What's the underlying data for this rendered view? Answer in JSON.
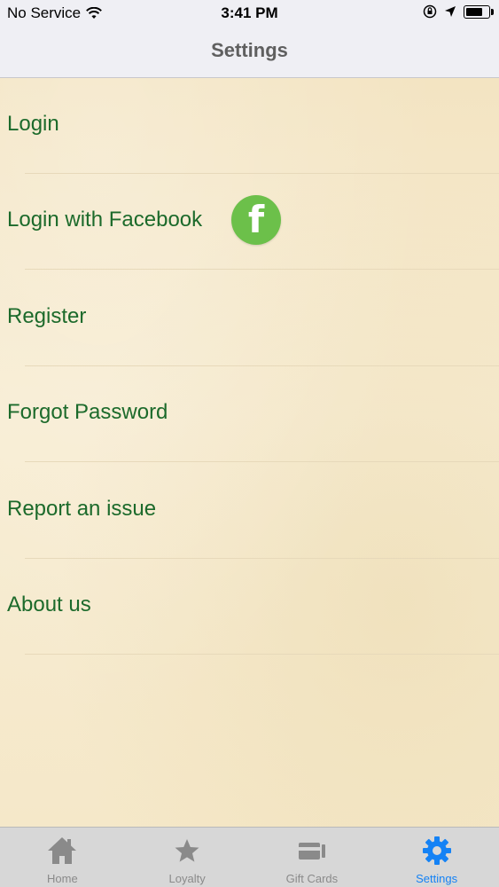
{
  "status_bar": {
    "carrier": "No Service",
    "time": "3:41 PM"
  },
  "nav": {
    "title": "Settings"
  },
  "menu": [
    {
      "label": "Login"
    },
    {
      "label": "Login with Facebook",
      "icon": "facebook-icon"
    },
    {
      "label": "Register"
    },
    {
      "label": "Forgot Password"
    },
    {
      "label": "Report an issue"
    },
    {
      "label": "About us"
    }
  ],
  "facebook_icon_text": "f",
  "tabs": [
    {
      "label": "Home",
      "icon": "home-icon"
    },
    {
      "label": "Loyalty",
      "icon": "star-icon"
    },
    {
      "label": "Gift Cards",
      "icon": "gift-card-icon"
    },
    {
      "label": "Settings",
      "icon": "gear-icon",
      "active": true
    }
  ],
  "colors": {
    "menu_text": "#1c6a2b",
    "active_tab": "#1482f5",
    "facebook_icon": "#6cc04a"
  }
}
